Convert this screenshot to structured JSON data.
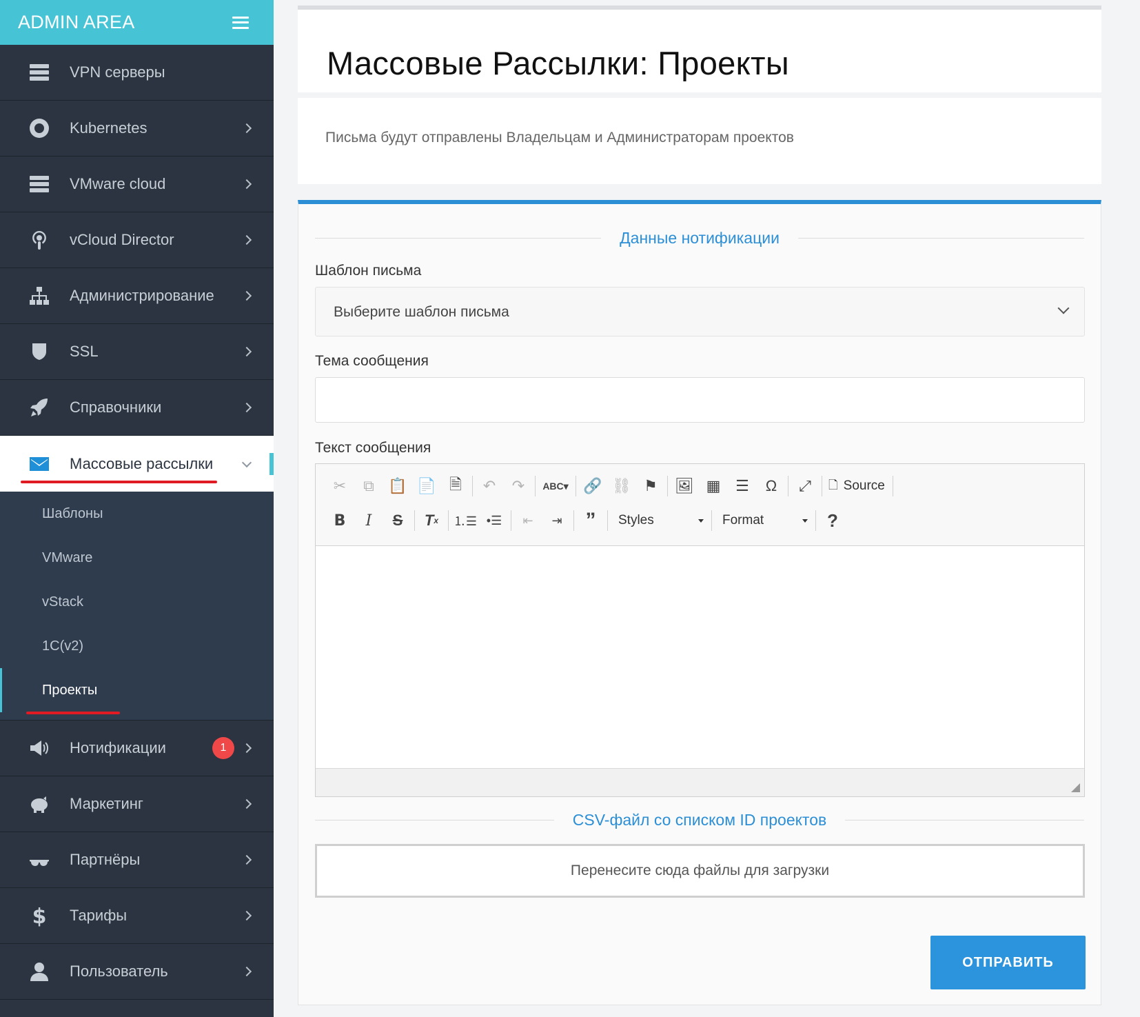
{
  "sidebar": {
    "brand": "ADMIN AREA",
    "items": [
      {
        "label": "VPN серверы",
        "icon": "server-icon"
      },
      {
        "label": "Kubernetes",
        "icon": "lifebuoy-icon"
      },
      {
        "label": "VMware cloud",
        "icon": "server-icon"
      },
      {
        "label": "vCloud Director",
        "icon": "podcast-icon"
      },
      {
        "label": "Администрирование",
        "icon": "sitemap-icon"
      },
      {
        "label": "SSL",
        "icon": "shield-icon"
      },
      {
        "label": "Справочники",
        "icon": "rocket-icon"
      },
      {
        "label": "Массовые рассылки",
        "icon": "envelope-icon"
      }
    ],
    "submenu": [
      "Шаблоны",
      "VMware",
      "vStack",
      "1C(v2)",
      "Проекты"
    ],
    "items_after": [
      {
        "label": "Нотификации",
        "icon": "megaphone-icon",
        "badge": "1"
      },
      {
        "label": "Маркетинг",
        "icon": "piggy-bank-icon"
      },
      {
        "label": "Партнёры",
        "icon": "glasses-icon"
      },
      {
        "label": "Тарифы",
        "icon": "dollar-icon"
      },
      {
        "label": "Пользователь",
        "icon": "user-icon"
      }
    ]
  },
  "main": {
    "title": "Массовые Рассылки: Проекты",
    "info": "Письма будут отправлены Владельцам и Администраторам проектов",
    "section_notification": "Данные нотификации",
    "template_label": "Шаблон письма",
    "template_placeholder": "Выберите шаблон письма",
    "subject_label": "Тема сообщения",
    "subject_value": "",
    "text_label": "Текст сообщения",
    "toolbar": {
      "source": "Source",
      "styles": "Styles",
      "format": "Format"
    },
    "section_csv": "CSV-файл со списком ID проектов",
    "dropzone": "Перенесите сюда файлы для загрузки",
    "submit": "ОТПРАВИТЬ"
  },
  "colors": {
    "brand": "#46c4d6",
    "sidebar": "#2b3440",
    "accent": "#2c8fd6",
    "badge": "#f04848",
    "highlight": "#e01b24"
  }
}
